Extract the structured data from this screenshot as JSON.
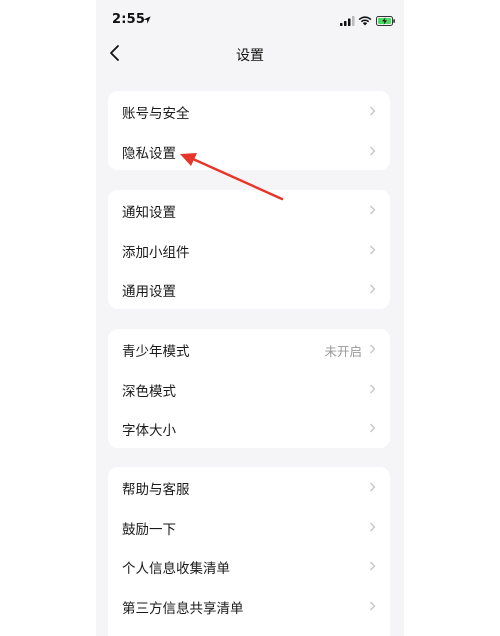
{
  "status_bar": {
    "time": "2:55"
  },
  "nav": {
    "title": "设置"
  },
  "groups": [
    {
      "items": [
        {
          "label": "账号与安全"
        },
        {
          "label": "隐私设置"
        }
      ]
    },
    {
      "items": [
        {
          "label": "通知设置"
        },
        {
          "label": "添加小组件"
        },
        {
          "label": "通用设置"
        }
      ]
    },
    {
      "items": [
        {
          "label": "青少年模式",
          "value": "未开启"
        },
        {
          "label": "深色模式"
        },
        {
          "label": "字体大小"
        }
      ]
    },
    {
      "items": [
        {
          "label": "帮助与客服"
        },
        {
          "label": "鼓励一下"
        },
        {
          "label": "个人信息收集清单"
        },
        {
          "label": "第三方信息共享清单"
        }
      ]
    }
  ],
  "colors": {
    "annotation_arrow": "#e8352a",
    "background": "#f5f5f7",
    "chevron": "#c4c4c6"
  },
  "icons": [
    "location-arrow-icon",
    "signal-icon",
    "wifi-icon",
    "battery-charging-icon",
    "back-chevron-icon",
    "chevron-right-icon"
  ]
}
